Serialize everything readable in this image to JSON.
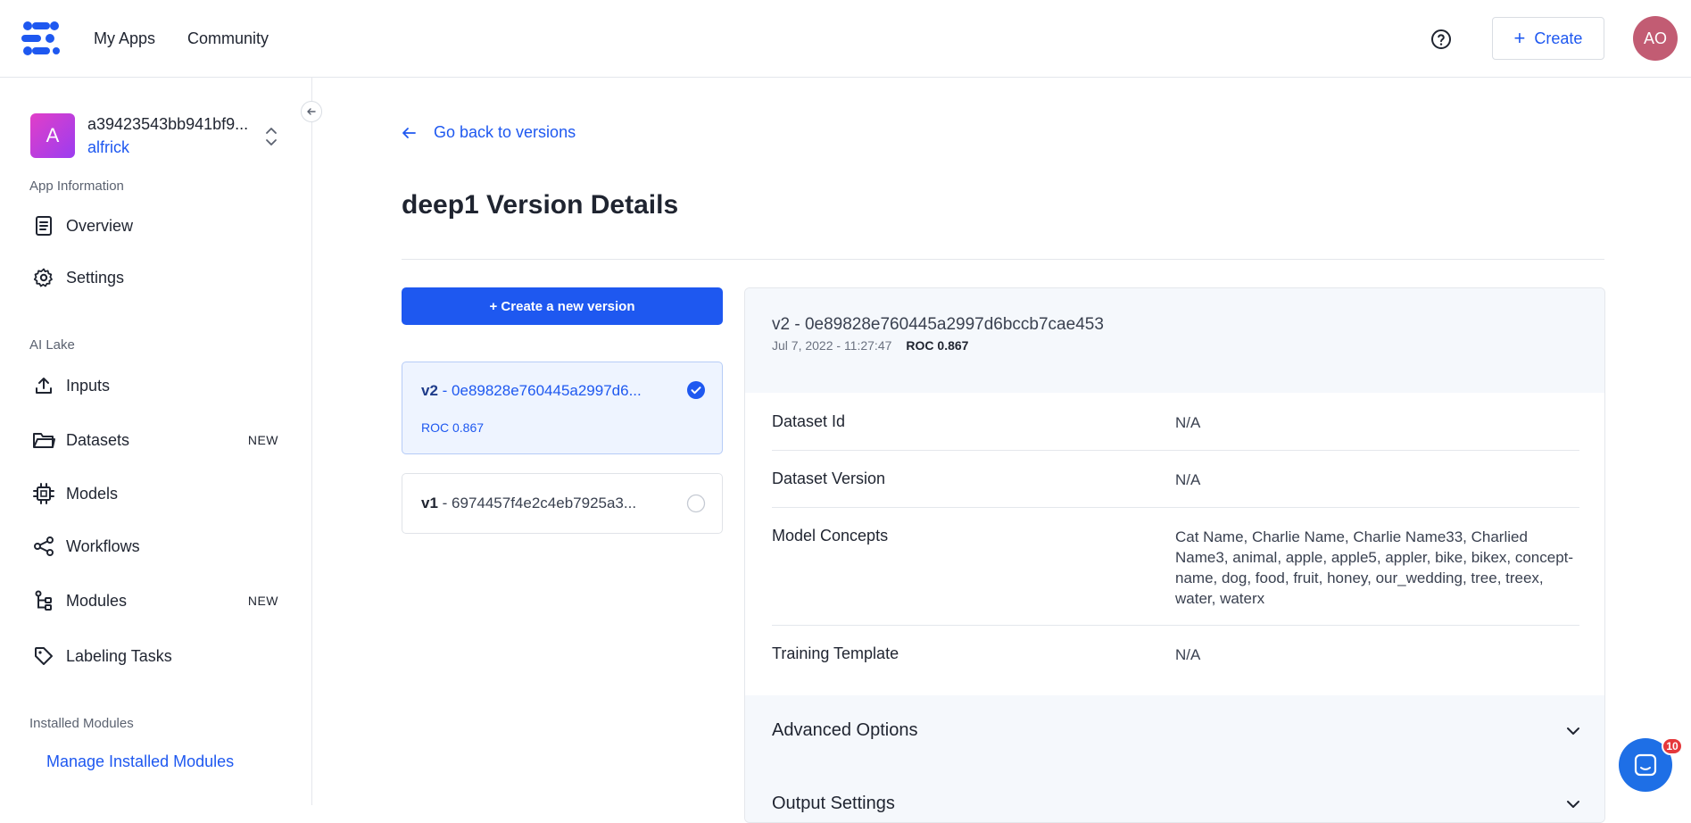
{
  "topbar": {
    "nav": [
      "My Apps",
      "Community"
    ],
    "create_label": "Create",
    "avatar_initials": "AO",
    "brand_color": "#1e58f0"
  },
  "sidebar": {
    "app": {
      "initial": "A",
      "name": "a39423543bb941bf9...",
      "owner": "alfrick"
    },
    "app_info_label": "App Information",
    "app_info_items": [
      {
        "label": "Overview",
        "icon": "document-icon"
      },
      {
        "label": "Settings",
        "icon": "gear-icon"
      }
    ],
    "ai_lake_label": "AI Lake",
    "ai_lake_items": [
      {
        "label": "Inputs",
        "icon": "upload-icon",
        "badge": ""
      },
      {
        "label": "Datasets",
        "icon": "folder-icon",
        "badge": "NEW"
      },
      {
        "label": "Models",
        "icon": "chip-icon",
        "badge": ""
      },
      {
        "label": "Workflows",
        "icon": "share-icon",
        "badge": ""
      },
      {
        "label": "Modules",
        "icon": "flow-icon",
        "badge": "NEW"
      },
      {
        "label": "Labeling Tasks",
        "icon": "tag-icon",
        "badge": ""
      }
    ],
    "installed_modules_label": "Installed Modules",
    "manage_link": "Manage Installed Modules"
  },
  "main": {
    "back_link": "Go back to versions",
    "title": "deep1 Version Details",
    "create_version_button": "+ Create a new version",
    "versions": [
      {
        "tag": "v2",
        "id": " - 0e89828e760445a2997d6...",
        "roc": "ROC 0.867",
        "selected": true
      },
      {
        "tag": "v1",
        "id": " - 6974457f4e2c4eb7925a3...",
        "roc": "",
        "selected": false
      }
    ],
    "detail": {
      "title": "v2 - 0e89828e760445a2997d6bccb7cae453",
      "date": "Jul 7, 2022 - 11:27:47",
      "roc": "ROC 0.867",
      "rows": [
        {
          "key": "Dataset Id",
          "value": "N/A"
        },
        {
          "key": "Dataset Version",
          "value": "N/A"
        },
        {
          "key": "Model Concepts",
          "value": "Cat Name, Charlie Name, Charlie Name33, Charlied Name3, animal, apple, apple5, appler, bike, bikex, concept-name, dog, food, fruit, honey, our_wedding, tree, treex, water, waterx"
        },
        {
          "key": "Training Template",
          "value": "N/A"
        }
      ],
      "accordions": [
        "Advanced Options",
        "Output Settings"
      ]
    }
  },
  "chat": {
    "badge_count": "10"
  }
}
